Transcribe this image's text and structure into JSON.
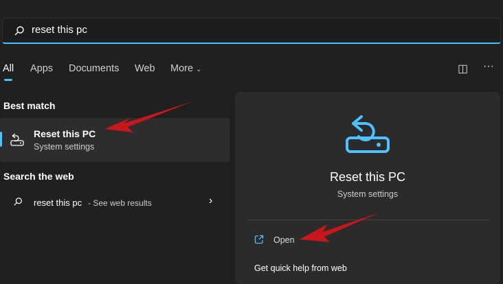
{
  "search": {
    "value": "reset this pc"
  },
  "tabs": [
    {
      "label": "All"
    },
    {
      "label": "Apps"
    },
    {
      "label": "Documents"
    },
    {
      "label": "Web"
    },
    {
      "label": "More"
    }
  ],
  "best_match": {
    "heading": "Best match",
    "title": "Reset this PC",
    "subtitle": "System settings"
  },
  "web": {
    "heading": "Search the web",
    "query": "reset this pc",
    "suffix": "- See web results"
  },
  "preview": {
    "title": "Reset this PC",
    "subtitle": "System settings",
    "open_label": "Open",
    "help_label": "Get quick help from web"
  },
  "colors": {
    "accent": "#4cc2ff",
    "annotation": "#c8161d"
  }
}
